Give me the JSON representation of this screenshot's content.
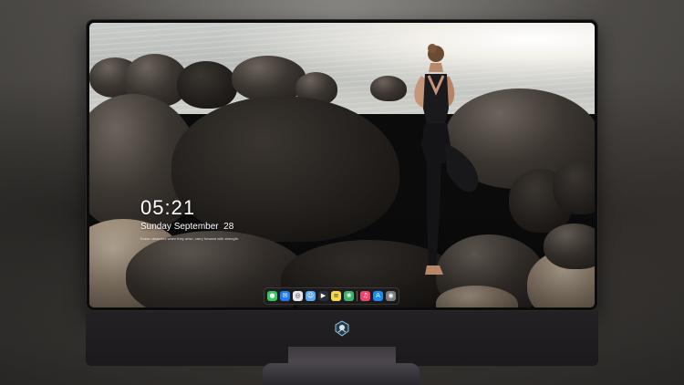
{
  "lock_screen": {
    "time": "05:21",
    "date": "Sunday September  28",
    "quote": "Erase obstacles when they arise, carry forward with strength"
  },
  "dock": {
    "apps": [
      {
        "name": "messages-icon",
        "color": "#34c759",
        "glyph": "●"
      },
      {
        "name": "mail-icon",
        "color": "#1e7cf2",
        "glyph": "✉"
      },
      {
        "name": "safari-icon",
        "color": "#e8e8ea",
        "glyph": "◎"
      },
      {
        "name": "finder-icon",
        "color": "#5aa9f0",
        "glyph": "☺"
      },
      {
        "name": "videos-icon",
        "color": "#2b2f35",
        "glyph": "▶"
      },
      {
        "name": "notes-icon",
        "color": "#f6d94a",
        "glyph": "≡"
      },
      {
        "name": "photos-icon",
        "color": "#3fb36b",
        "glyph": "❀"
      },
      {
        "name": "music-icon",
        "color": "#f0436a",
        "glyph": "♫"
      },
      {
        "name": "app-store-icon",
        "color": "#1c8cf0",
        "glyph": "A"
      },
      {
        "name": "camera-icon",
        "color": "#7b7b80",
        "glyph": "◉"
      }
    ]
  },
  "colors": {
    "bezel": "#0b0b0c",
    "chin": "#242124",
    "stand": "#4a464c"
  }
}
